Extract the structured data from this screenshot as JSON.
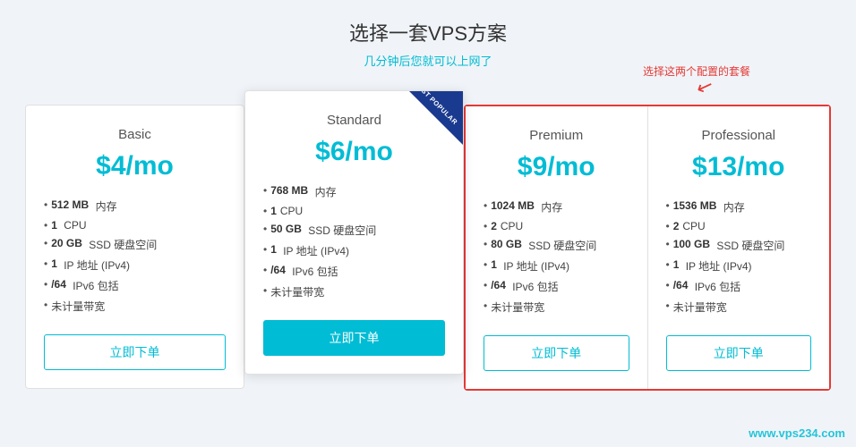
{
  "page": {
    "title": "选择一套VPS方案",
    "subtitle": "几分钟后您就可以上网了",
    "annotation_text": "选择这两个配置的套餐"
  },
  "plans": [
    {
      "id": "basic",
      "name": "Basic",
      "price": "$4/mo",
      "features": [
        {
          "bold": "512 MB",
          "text": " 内存"
        },
        {
          "bold": "1",
          "text": " CPU"
        },
        {
          "bold": "20 GB",
          "text": " SSD 硬盘空间"
        },
        {
          "bold": "1",
          "text": " IP 地址 (IPv4)"
        },
        {
          "bold": "/64",
          "text": " IPv6 包括"
        },
        {
          "bold": "",
          "text": "未计量带宽"
        }
      ],
      "btn_label": "立即下单",
      "btn_type": "outline"
    },
    {
      "id": "standard",
      "name": "Standard",
      "price": "$6/mo",
      "most_popular": "MOST POPULAR",
      "features": [
        {
          "bold": "768 MB",
          "text": " 内存"
        },
        {
          "bold": "1",
          "text": "CPU"
        },
        {
          "bold": "50 GB",
          "text": " SSD 硬盘空间"
        },
        {
          "bold": "1",
          "text": " IP 地址 (IPv4)"
        },
        {
          "bold": "/64",
          "text": " IPv6 包括"
        },
        {
          "bold": "",
          "text": "未计量带宽"
        }
      ],
      "btn_label": "立即下单",
      "btn_type": "filled"
    },
    {
      "id": "premium",
      "name": "Premium",
      "price": "$9/mo",
      "features": [
        {
          "bold": "1024 MB",
          "text": " 内存"
        },
        {
          "bold": "2",
          "text": "CPU"
        },
        {
          "bold": "80 GB",
          "text": " SSD 硬盘空间"
        },
        {
          "bold": "1",
          "text": " IP 地址 (IPv4)"
        },
        {
          "bold": "/64",
          "text": " IPv6 包括"
        },
        {
          "bold": "",
          "text": "未计量带宽"
        }
      ],
      "btn_label": "立即下单",
      "btn_type": "outline"
    },
    {
      "id": "professional",
      "name": "Professional",
      "price": "$13/mo",
      "features": [
        {
          "bold": "1536 MB",
          "text": " 内存"
        },
        {
          "bold": "2",
          "text": "CPU"
        },
        {
          "bold": "100 GB",
          "text": " SSD 硬盘空间"
        },
        {
          "bold": "1",
          "text": " IP 地址 (IPv4)"
        },
        {
          "bold": "/64",
          "text": " IPv6 包括"
        },
        {
          "bold": "",
          "text": "未计量带宽"
        }
      ],
      "btn_label": "立即下单",
      "btn_type": "outline"
    }
  ],
  "watermark": "www.vps234.com"
}
